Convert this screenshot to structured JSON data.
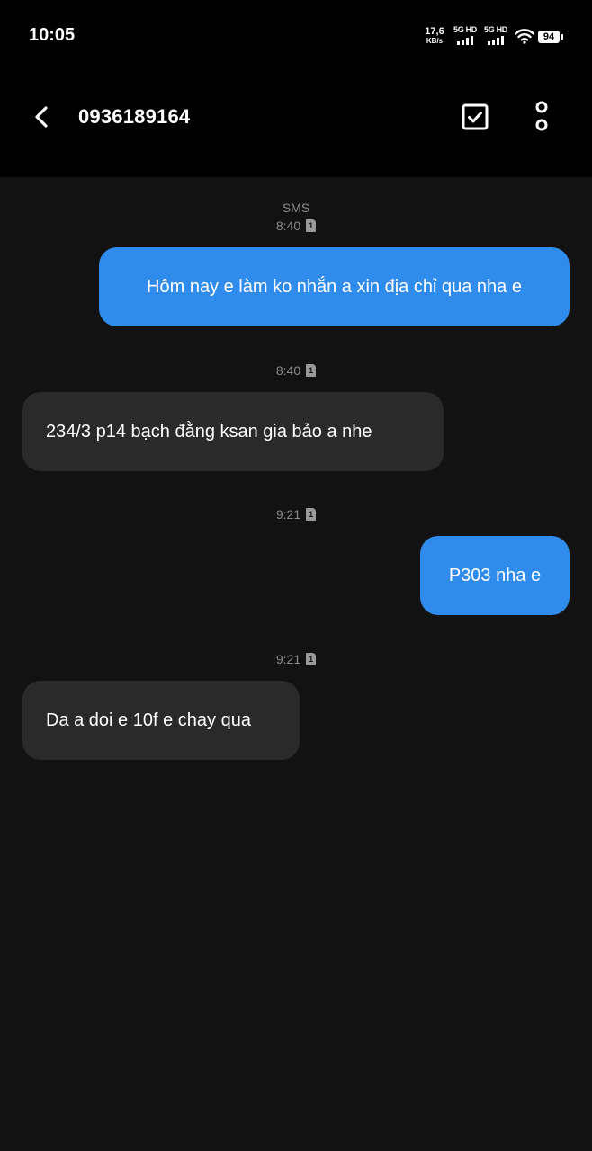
{
  "status_bar": {
    "time": "10:05",
    "net_speed_value": "17,6",
    "net_speed_unit": "KB/s",
    "sim1_label": "5G HD",
    "sim2_label": "5G HD",
    "battery": "94",
    "icons": [
      "signal-icon",
      "signal-icon",
      "wifi-icon",
      "battery-icon"
    ]
  },
  "header": {
    "title": "0936189164",
    "icons": [
      "back-arrow-icon",
      "select-checkbox-icon",
      "more-vert-icon"
    ]
  },
  "thread": {
    "channel_label": "SMS",
    "sim_badge": "1",
    "messages": [
      {
        "direction": "outgoing",
        "time": "8:40",
        "text": "Hôm nay e làm ko nhắn a xin địa chỉ qua nha e"
      },
      {
        "direction": "incoming",
        "time": "8:40",
        "text": "234/3 p14 bạch đằng ksan gia bảo a nhe"
      },
      {
        "direction": "outgoing",
        "time": "9:21",
        "text": "P303 nha e"
      },
      {
        "direction": "incoming",
        "time": "9:21",
        "text": "Da a doi e 10f e chay qua"
      }
    ]
  },
  "colors": {
    "background": "#121212",
    "header_background": "#000000",
    "outgoing_bubble": "#2f8cec",
    "incoming_bubble": "#2a2a2a",
    "meta_text": "#8a8a8a"
  }
}
